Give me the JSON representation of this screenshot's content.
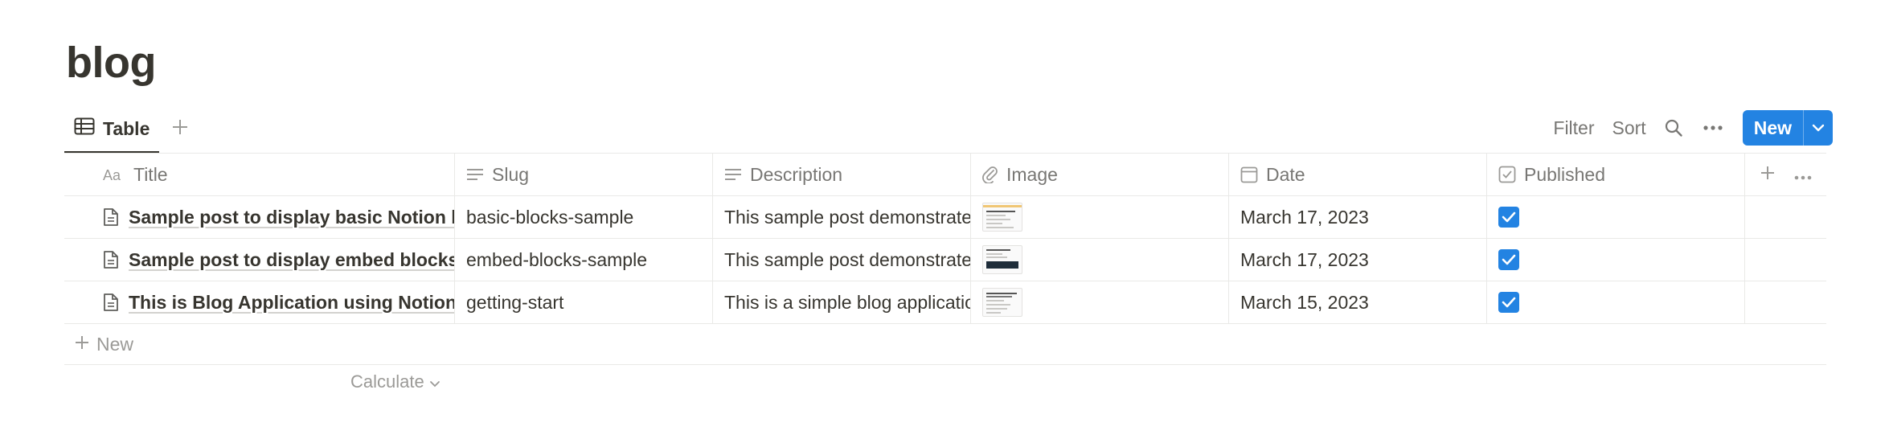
{
  "page": {
    "title": "blog"
  },
  "viewbar": {
    "active_view": {
      "label": "Table",
      "icon": "table-icon"
    },
    "add_view_icon": "plus-icon",
    "tools": {
      "filter": "Filter",
      "sort": "Sort",
      "search_icon": "search-icon",
      "more_icon": "more-horizontal-icon"
    },
    "new_button": {
      "label": "New",
      "caret_icon": "chevron-down-icon"
    }
  },
  "table": {
    "columns": [
      {
        "label": "Title",
        "icon": "text-aa-icon"
      },
      {
        "label": "Slug",
        "icon": "text-lines-icon"
      },
      {
        "label": "Description",
        "icon": "text-lines-icon"
      },
      {
        "label": "Image",
        "icon": "paperclip-icon"
      },
      {
        "label": "Date",
        "icon": "calendar-icon"
      },
      {
        "label": "Published",
        "icon": "checkbox-icon"
      }
    ],
    "rows": [
      {
        "title": "Sample post to display basic Notion blocks",
        "slug": "basic-blocks-sample",
        "description": "This sample post demonstrates",
        "date": "March 17, 2023",
        "published": true
      },
      {
        "title": "Sample post to display embed blocks",
        "slug": "embed-blocks-sample",
        "description": "This sample post demonstrates",
        "date": "March 17, 2023",
        "published": true
      },
      {
        "title": "This is Blog Application using Notion API",
        "slug": "getting-start",
        "description": "This is a simple blog application",
        "date": "March 15, 2023",
        "published": true
      }
    ],
    "new_row_label": "New",
    "calculate_label": "Calculate"
  },
  "colors": {
    "accent": "#2383e2",
    "text": "#37352f",
    "muted": "#787774",
    "border": "#e9e9e7"
  }
}
